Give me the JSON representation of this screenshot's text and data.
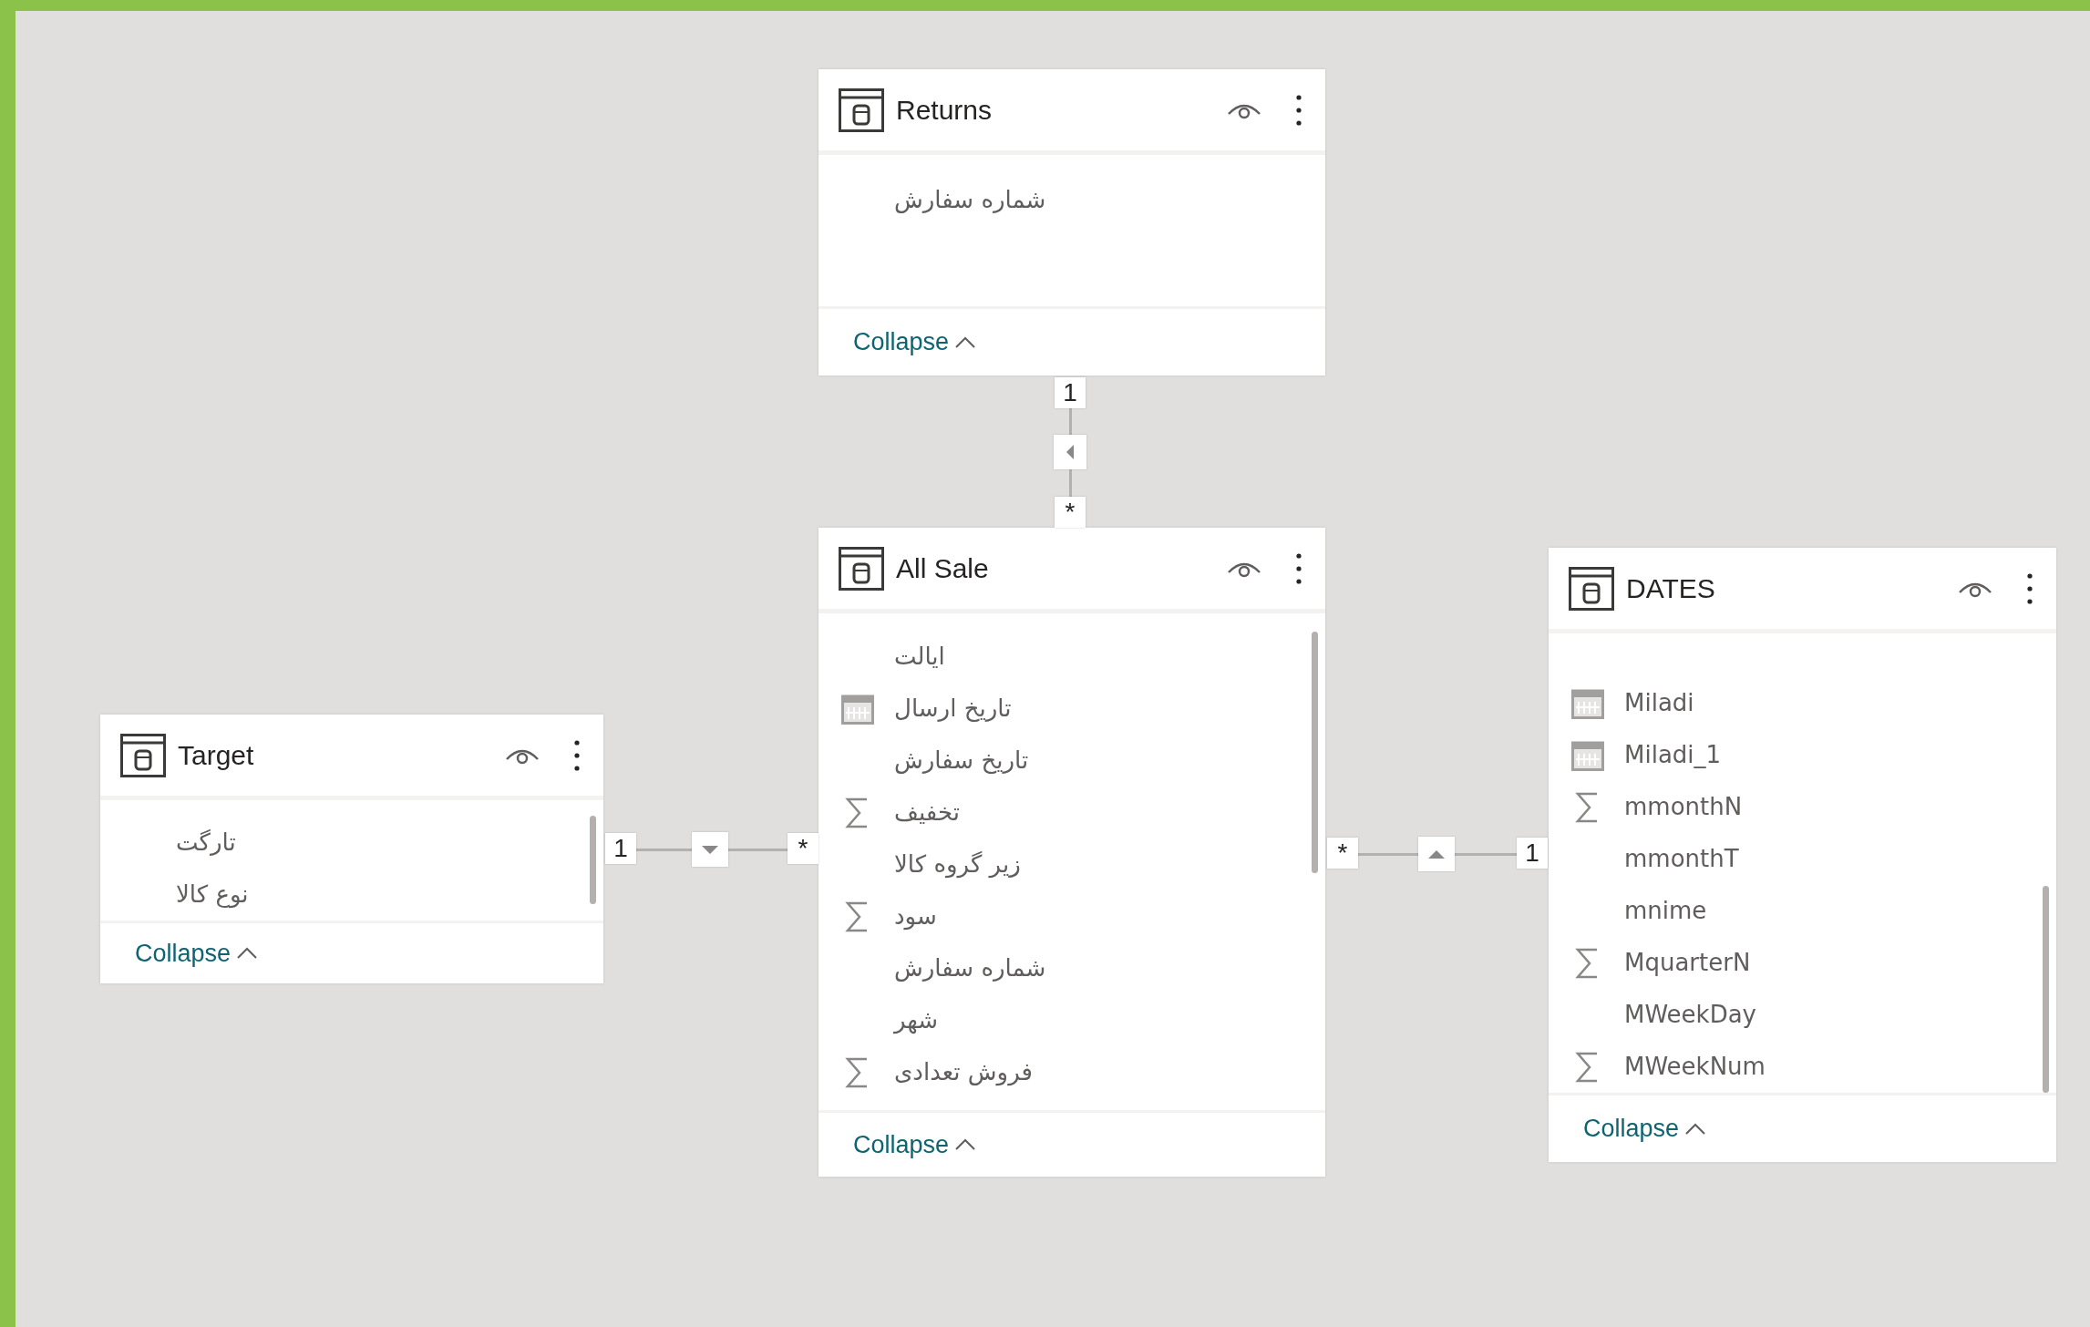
{
  "tables": [
    {
      "name": "Returns",
      "fields": [
        {
          "label": "شماره سفارش",
          "kind": "plain"
        }
      ],
      "collapse_label": "Collapse"
    },
    {
      "name": "DATES",
      "fields": [
        {
          "label": "Miladi",
          "kind": "date"
        },
        {
          "label": "Miladi_1",
          "kind": "date"
        },
        {
          "label": "mmonthN",
          "kind": "sum"
        },
        {
          "label": "mmonthT",
          "kind": "plain"
        },
        {
          "label": "mnime",
          "kind": "plain"
        },
        {
          "label": "MquarterN",
          "kind": "sum"
        },
        {
          "label": "MWeekDay",
          "kind": "plain"
        },
        {
          "label": "MWeekNum",
          "kind": "sum"
        }
      ],
      "collapse_label": "Collapse"
    },
    {
      "name": "All Sale",
      "fields": [
        {
          "label": "ایالت",
          "kind": "plain"
        },
        {
          "label": "تاریخ ارسال",
          "kind": "date"
        },
        {
          "label": "تاریخ سفارش",
          "kind": "plain"
        },
        {
          "label": "تخفیف",
          "kind": "sum"
        },
        {
          "label": "زیر گروه کالا",
          "kind": "plain"
        },
        {
          "label": "سود",
          "kind": "sum"
        },
        {
          "label": "شماره سفارش",
          "kind": "plain"
        },
        {
          "label": "شهر",
          "kind": "plain"
        },
        {
          "label": "فروش تعدادی",
          "kind": "sum"
        }
      ],
      "collapse_label": "Collapse"
    },
    {
      "name": "Target",
      "fields": [
        {
          "label": "تارگت",
          "kind": "plain"
        },
        {
          "label": "نوع کالا",
          "kind": "plain"
        }
      ],
      "collapse_label": "Collapse"
    }
  ],
  "relationships": [
    {
      "one_label": "1",
      "many_label": "*",
      "kind": "left"
    },
    {
      "one_label": "1",
      "many_label": "*",
      "kind": "down"
    },
    {
      "one_label": "1",
      "many_label": "*",
      "kind": "up"
    }
  ]
}
